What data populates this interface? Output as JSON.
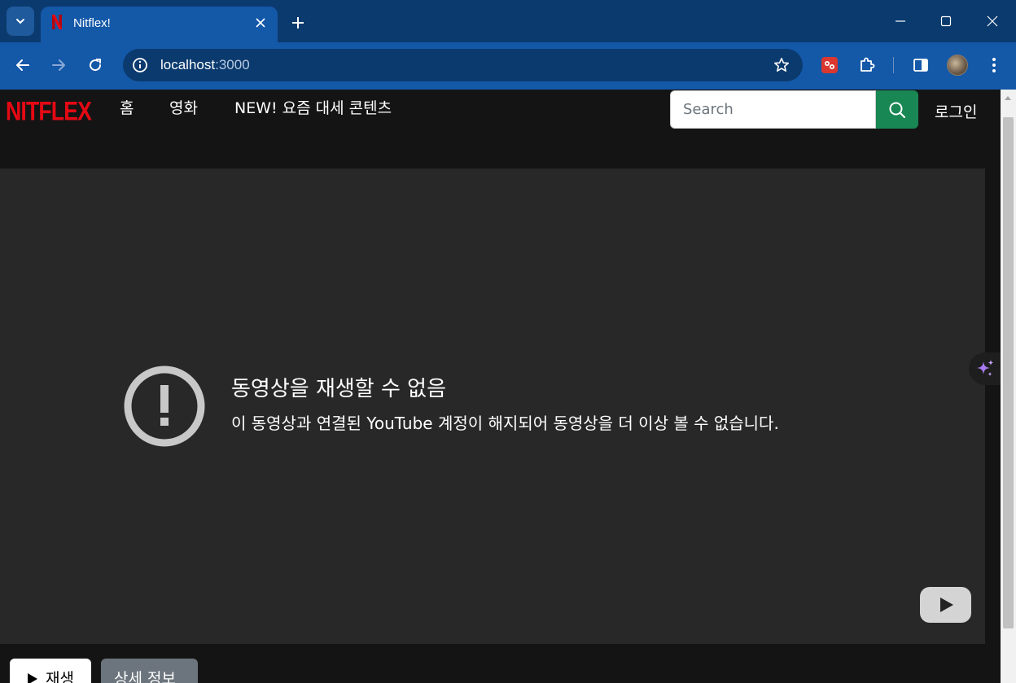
{
  "browser": {
    "tab_title": "Nitflex!",
    "url_host": "localhost",
    "url_port": ":3000"
  },
  "site": {
    "logo_text": "NITFLEX",
    "nav": [
      "홈",
      "영화",
      "NEW! 요즘 대세 콘텐츠"
    ],
    "search_placeholder": "Search",
    "login_label": "로그인"
  },
  "player": {
    "error_title": "동영상을 재생할 수 없음",
    "error_message": "이 동영상과 연결된 YouTube 계정이 해지되어 동영상을 더 이상 볼 수 없습니다."
  },
  "actions": {
    "play_label": "재생",
    "info_label": "상세 정보"
  },
  "colors": {
    "brand_red": "#e50914",
    "search_green": "#198754",
    "chrome_blue": "#1458a8"
  }
}
